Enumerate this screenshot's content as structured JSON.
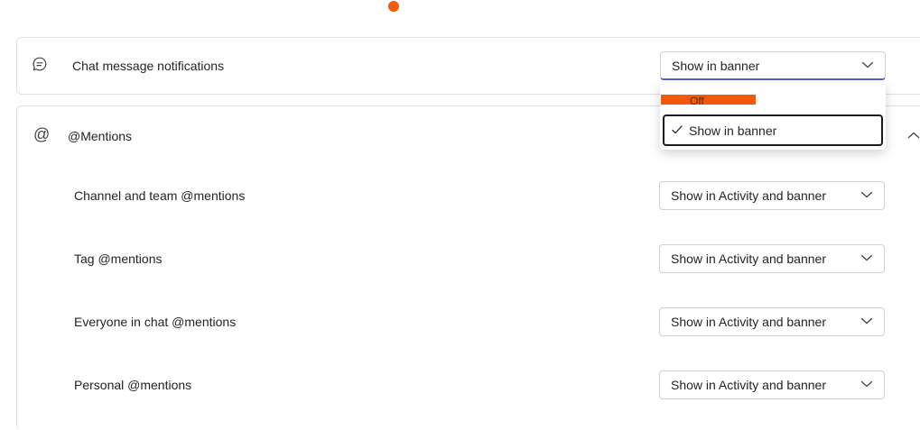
{
  "chat": {
    "label": "Chat message notifications",
    "value": "Show in banner",
    "dropdown_options": [
      "Off",
      "Show in banner"
    ],
    "selected_option": "Show in banner"
  },
  "mentions": {
    "title": "@Mentions",
    "rows": [
      {
        "label": "Channel and team @mentions",
        "value": "Show in Activity and banner"
      },
      {
        "label": "Tag @mentions",
        "value": "Show in Activity and banner"
      },
      {
        "label": "Everyone in chat @mentions",
        "value": "Show in Activity and banner"
      },
      {
        "label": "Personal @mentions",
        "value": "Show in Activity and banner"
      }
    ]
  },
  "icons": {
    "chat": "chat-bubble-icon",
    "mention": "at-sign-icon",
    "dropdown": "chevron-down-icon",
    "collapse": "chevron-up-icon",
    "check": "checkmark-icon"
  },
  "colors": {
    "accent": "#5b5fc7",
    "highlight": "#f05a0a",
    "border": "#d1d1d1"
  }
}
